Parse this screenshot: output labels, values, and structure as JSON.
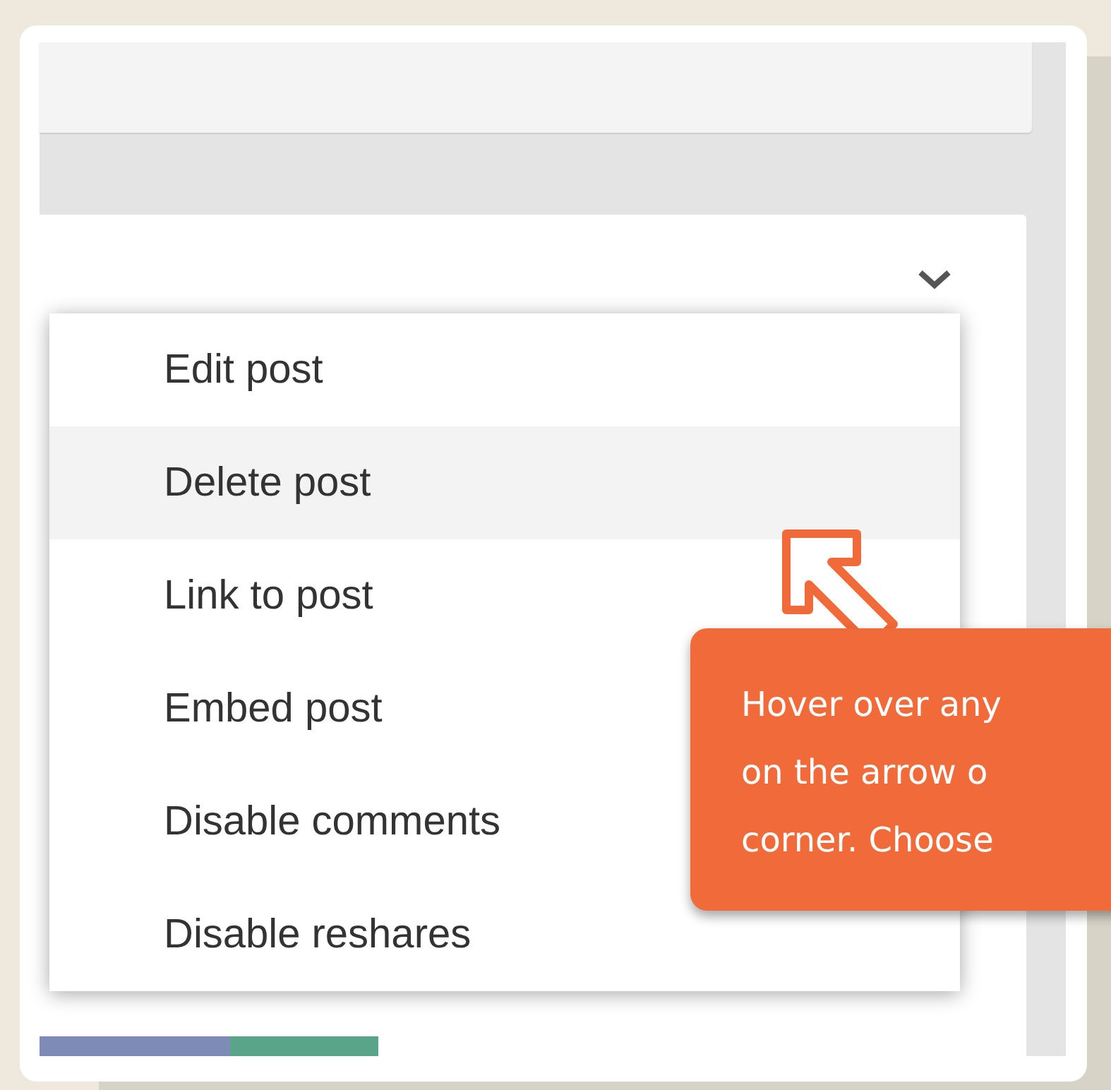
{
  "menu": {
    "items": [
      {
        "label": "Edit post",
        "selected": false
      },
      {
        "label": "Delete post",
        "selected": true
      },
      {
        "label": "Link to post",
        "selected": false
      },
      {
        "label": "Embed post",
        "selected": false
      },
      {
        "label": "Disable comments",
        "selected": false
      },
      {
        "label": "Disable reshares",
        "selected": false
      }
    ]
  },
  "tooltip": {
    "lines": [
      "Hover over any",
      "on the arrow o",
      "corner. Choose"
    ]
  }
}
